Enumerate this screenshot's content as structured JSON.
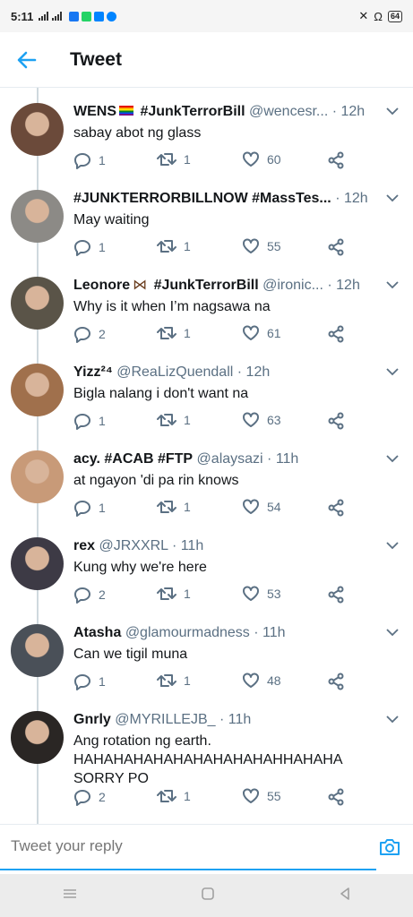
{
  "status_bar": {
    "time": "5:11",
    "battery": "64"
  },
  "header": {
    "title": "Tweet"
  },
  "tweets": [
    {
      "name": "WENS",
      "badge": "rainbow-flag",
      "tag": "#JunkTerrorBill",
      "handle": "@wencesr...",
      "time": "· 12h",
      "text": "sabay abot ng glass",
      "replies": "1",
      "retweets": "1",
      "likes": "60",
      "avatar_color": "#6b4a3a"
    },
    {
      "name": "#JUNKTERRORBILLNOW #MassTes...",
      "badge": "",
      "tag": "",
      "handle": "",
      "time": "· 12h",
      "text": "May waiting",
      "replies": "1",
      "retweets": "1",
      "likes": "55",
      "avatar_color": "#8c8a86"
    },
    {
      "name": "Leonore",
      "badge": "butterfly",
      "tag": "#JunkTerrorBill",
      "handle": "@ironic...",
      "time": "· 12h",
      "text": "Why is it when I’m nagsawa na",
      "replies": "2",
      "retweets": "1",
      "likes": "61",
      "avatar_color": "#5a5448"
    },
    {
      "name": "Yizz²⁴",
      "badge": "",
      "tag": "",
      "handle": "@ReaLizQuendall",
      "time": "· 12h",
      "text": "Bigla nalang i don't want na",
      "replies": "1",
      "retweets": "1",
      "likes": "63",
      "avatar_color": "#a0704c"
    },
    {
      "name": "acy.",
      "badge": "",
      "tag": "#ACAB #FTP",
      "handle": "@alaysazi",
      "time": "· 11h",
      "text": "at ngayon 'di pa rin knows",
      "replies": "1",
      "retweets": "1",
      "likes": "54",
      "avatar_color": "#c89a78"
    },
    {
      "name": "rex",
      "badge": "",
      "tag": "",
      "handle": "@JRXXRL",
      "time": "· 11h",
      "text": "Kung why we're here",
      "replies": "2",
      "retweets": "1",
      "likes": "53",
      "avatar_color": "#3d3a45"
    },
    {
      "name": "Atasha",
      "badge": "",
      "tag": "",
      "handle": "@glamourmadness",
      "time": "· 11h",
      "text": "Can we tigil muna",
      "replies": "1",
      "retweets": "1",
      "likes": "48",
      "avatar_color": "#4a5058"
    },
    {
      "name": "Gnrly",
      "badge": "",
      "tag": "",
      "handle": "@MYRILLEJB_",
      "time": "· 11h",
      "text": "Ang rotation ng earth. HAHAHAHAHAHAHAHAHAHAHHAHAHA SORRY PO",
      "replies": "2",
      "retweets": "1",
      "likes": "55",
      "avatar_color": "#2a2624"
    }
  ],
  "reply_bar": {
    "placeholder": "Tweet your reply"
  },
  "colors": {
    "accent": "#1da1f2",
    "secondary_text": "#5b7083",
    "divider": "#e6ecf0"
  }
}
